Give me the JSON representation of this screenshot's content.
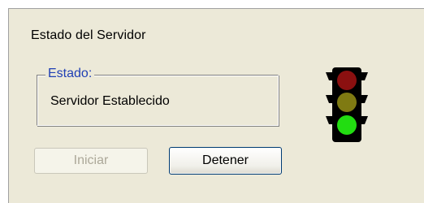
{
  "panel": {
    "title": "Estado del Servidor"
  },
  "status_group": {
    "legend": "Estado:",
    "value": "Servidor Establecido"
  },
  "buttons": {
    "start_label": "Iniciar",
    "stop_label": "Detener"
  },
  "traffic_light": {
    "icon": "traffic-light-icon",
    "active_light": "green",
    "colors": {
      "red_off": "#8b1010",
      "yellow_off": "#7f7a12",
      "green_on": "#22dd11",
      "body": "#000000"
    }
  }
}
